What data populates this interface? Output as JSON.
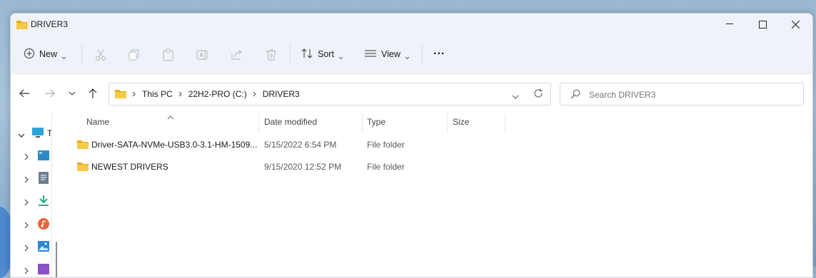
{
  "window": {
    "title": "DRIVER3"
  },
  "toolbar": {
    "new_label": "New",
    "sort_label": "Sort",
    "view_label": "View",
    "more_label": "..."
  },
  "address": {
    "crumbs": [
      "This PC",
      "22H2-PRO (C:)",
      "DRIVER3"
    ]
  },
  "search": {
    "placeholder": "Search DRIVER3"
  },
  "nav": {
    "root_label": "T"
  },
  "columns": {
    "name": "Name",
    "date": "Date modified",
    "type": "Type",
    "size": "Size"
  },
  "files": [
    {
      "name": "Driver-SATA-NVMe-USB3.0-3.1-HM-1509...",
      "date": "5/15/2022 6:54 PM",
      "type": "File folder",
      "size": ""
    },
    {
      "name": "NEWEST DRIVERS",
      "date": "9/15/2020 12:52 PM",
      "type": "File folder",
      "size": ""
    }
  ],
  "colors": {
    "folder": "#f5c242",
    "accent": "#0067c0"
  }
}
